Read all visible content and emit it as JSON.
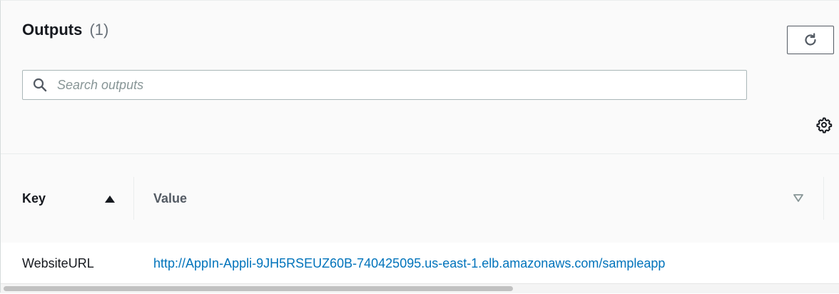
{
  "header": {
    "title": "Outputs",
    "count": "(1)"
  },
  "toolbar": {
    "refresh_icon": "refresh-icon",
    "settings_icon": "gear-icon"
  },
  "search": {
    "placeholder": "Search outputs",
    "value": "",
    "icon": "search-icon"
  },
  "table": {
    "columns": [
      {
        "label": "Key",
        "sort": "ascending"
      },
      {
        "label": "Value",
        "sort": "sortable"
      }
    ],
    "rows": [
      {
        "key": "WebsiteURL",
        "value": "http://AppIn-Appli-9JH5RSEUZ60B-740425095.us-east-1.elb.amazonaws.com/sampleapp"
      }
    ]
  },
  "colors": {
    "link": "#0073bb",
    "text": "#16191f",
    "muted": "#687078",
    "border": "#aab7b8"
  }
}
